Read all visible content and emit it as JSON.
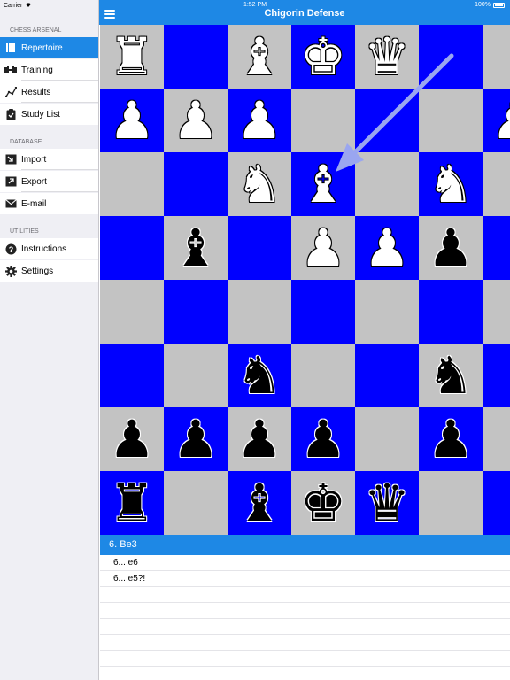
{
  "status": {
    "carrier": "Carrier",
    "time": "1:52 PM",
    "battery": "100%"
  },
  "sidebar": {
    "sections": [
      {
        "header": "CHESS ARSENAL",
        "items": [
          {
            "label": "Repertoire",
            "icon": "book-icon",
            "active": true
          },
          {
            "label": "Training",
            "icon": "dumbbell-icon"
          },
          {
            "label": "Results",
            "icon": "trend-line-icon"
          },
          {
            "label": "Study List",
            "icon": "clipboard-icon"
          }
        ]
      },
      {
        "header": "DATABASE",
        "items": [
          {
            "label": "Import",
            "icon": "import-icon"
          },
          {
            "label": "Export",
            "icon": "export-icon"
          },
          {
            "label": "E-mail",
            "icon": "envelope-icon"
          }
        ]
      },
      {
        "header": "UTILITIES",
        "items": [
          {
            "label": "Instructions",
            "icon": "question-icon"
          },
          {
            "label": "Settings",
            "icon": "gear-icon"
          }
        ]
      }
    ]
  },
  "navbar": {
    "title": "Chigorin Defense"
  },
  "board": {
    "colors": {
      "light": "#c3c3c3",
      "dark": "#0000ff"
    },
    "rows": [
      [
        "wR",
        "",
        "wB",
        "wK",
        "wQ",
        "",
        "",
        ""
      ],
      [
        "wP",
        "wP",
        "wP",
        "",
        "",
        "",
        "wP",
        ""
      ],
      [
        "",
        "",
        "wN",
        "wB",
        "",
        "wN",
        "",
        ""
      ],
      [
        "",
        "bB",
        "",
        "wP",
        "wP",
        "bP",
        "",
        ""
      ],
      [
        "",
        "",
        "",
        "",
        "",
        "",
        "",
        ""
      ],
      [
        "",
        "",
        "bN",
        "",
        "",
        "bN",
        "",
        ""
      ],
      [
        "bP",
        "bP",
        "bP",
        "bP",
        "",
        "bP",
        "",
        ""
      ],
      [
        "bR",
        "",
        "bB",
        "bK",
        "bQ",
        "",
        "",
        ""
      ]
    ]
  },
  "moves": {
    "current": "6. Be3",
    "options": [
      "6... e6",
      "6... e5?!"
    ],
    "empty_rows": 6
  },
  "accent": "#1e88e5"
}
